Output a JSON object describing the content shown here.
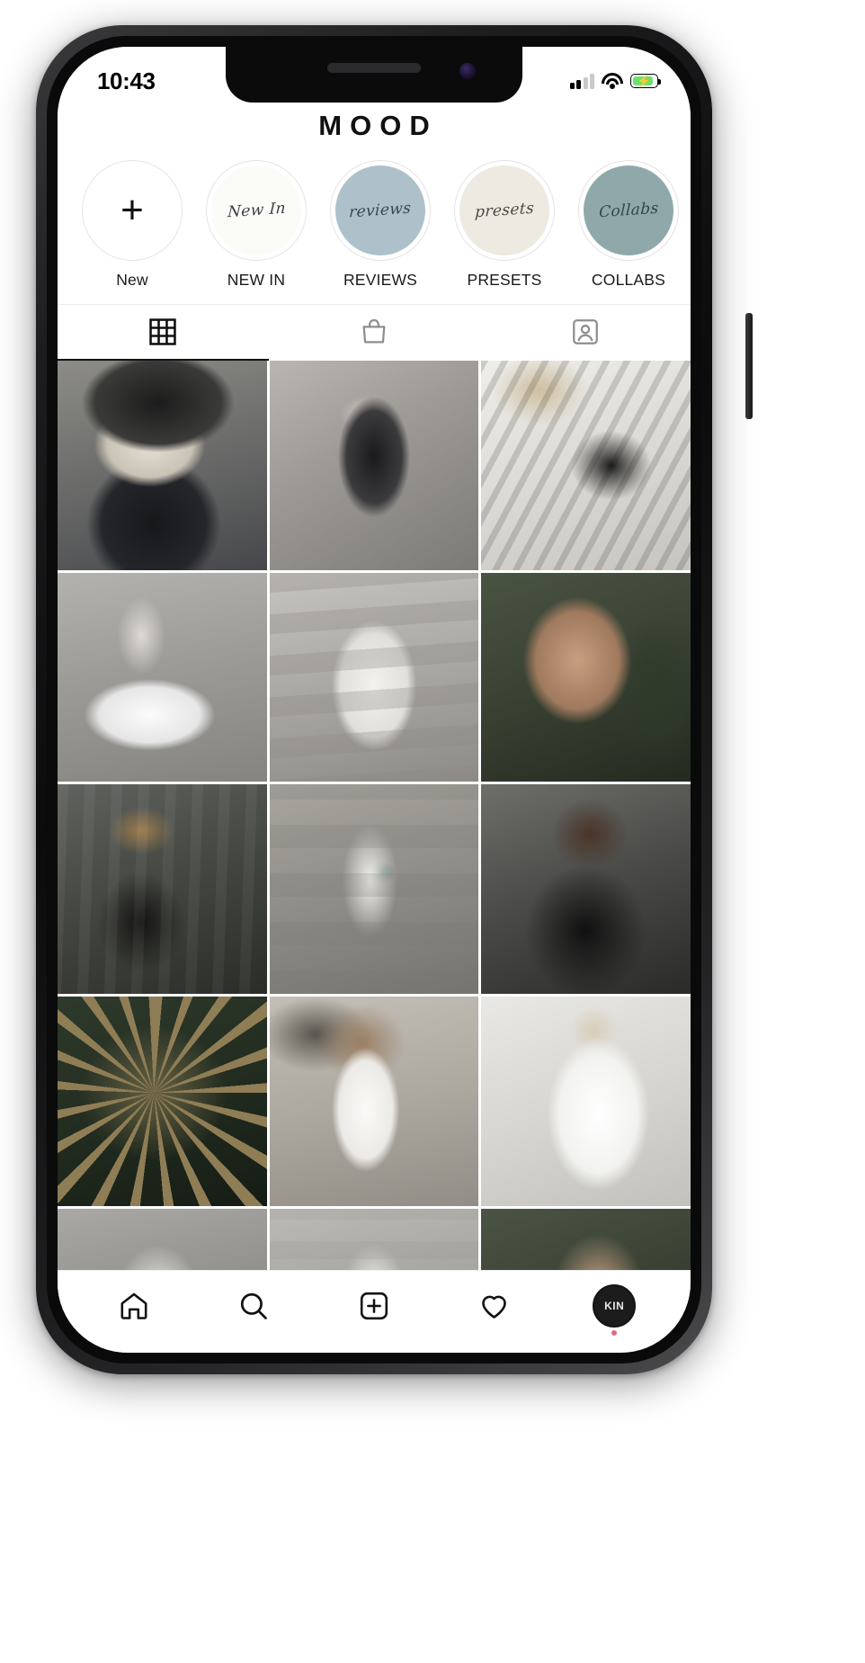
{
  "status_bar": {
    "time": "10:43",
    "signal_icon": "cellular-signal-icon",
    "signal_bars_filled": 2,
    "signal_bars_total": 4,
    "wifi_icon": "wifi-icon",
    "battery_icon": "battery-charging-icon",
    "battery_color": "#6ee06e",
    "battery_charging": true
  },
  "header": {
    "brand": "MOOD"
  },
  "highlights": [
    {
      "label": "New",
      "script": "",
      "icon": "plus-icon",
      "fill": "#ffffff",
      "text_color": "#111111"
    },
    {
      "label": "NEW IN",
      "script": "New In",
      "icon": "",
      "fill": "#fbfbf8",
      "text_color": "#3d4245"
    },
    {
      "label": "REVIEWS",
      "script": "reviews",
      "icon": "",
      "fill": "#aec1ca",
      "text_color": "#39474e"
    },
    {
      "label": "PRESETS",
      "script": "presets",
      "icon": "",
      "fill": "#eceae1",
      "text_color": "#4a4a46"
    },
    {
      "label": "COLLABS",
      "script": "Collabs",
      "icon": "",
      "fill": "#8fa9ab",
      "text_color": "#32464a"
    }
  ],
  "tabs": [
    {
      "name": "grid",
      "icon": "grid-icon",
      "active": true
    },
    {
      "name": "shop",
      "icon": "shopping-bag-icon",
      "active": false
    },
    {
      "name": "tagged",
      "icon": "tagged-person-icon",
      "active": false
    }
  ],
  "grid": {
    "cells": [
      {
        "art": "p1",
        "alt": "woman in leather bucket hat and black tank top"
      },
      {
        "art": "p2",
        "alt": "black and white beach swimsuit portrait"
      },
      {
        "art": "p3",
        "alt": "chanel tweed cardigan with pearl necklace"
      },
      {
        "art": "p4",
        "alt": "white balenciaga triple s sneakers"
      },
      {
        "art": "p5",
        "alt": "woman in white suit on stone steps"
      },
      {
        "art": "p6",
        "alt": "portrait of girl among green palm leaves"
      },
      {
        "art": "p7",
        "alt": "man in tan cap and black jacket"
      },
      {
        "art": "p8",
        "alt": "woman in white blazer with green belt bag"
      },
      {
        "art": "p9",
        "alt": "man in black outfit with sunglasses"
      },
      {
        "art": "p10",
        "alt": "overhead view of palm tree fronds"
      },
      {
        "art": "p11",
        "alt": "woman in white swimsuit against rocks"
      },
      {
        "art": "p12",
        "alt": "woman in oversized white shirt"
      },
      {
        "art": "p13",
        "alt": "white sneaker close up"
      },
      {
        "art": "p14",
        "alt": "woman in white on steps cropped"
      },
      {
        "art": "p15",
        "alt": "portrait among leaves cropped"
      }
    ]
  },
  "bottom_nav": [
    {
      "name": "home",
      "icon": "home-icon",
      "active": true,
      "badge": false
    },
    {
      "name": "search",
      "icon": "search-icon",
      "active": false,
      "badge": false
    },
    {
      "name": "create",
      "icon": "plus-square-icon",
      "active": false,
      "badge": false
    },
    {
      "name": "activity",
      "icon": "heart-icon",
      "active": false,
      "badge": false
    },
    {
      "name": "profile",
      "icon": "avatar-icon",
      "active": false,
      "badge": true,
      "avatar_text": "KIN"
    }
  ]
}
